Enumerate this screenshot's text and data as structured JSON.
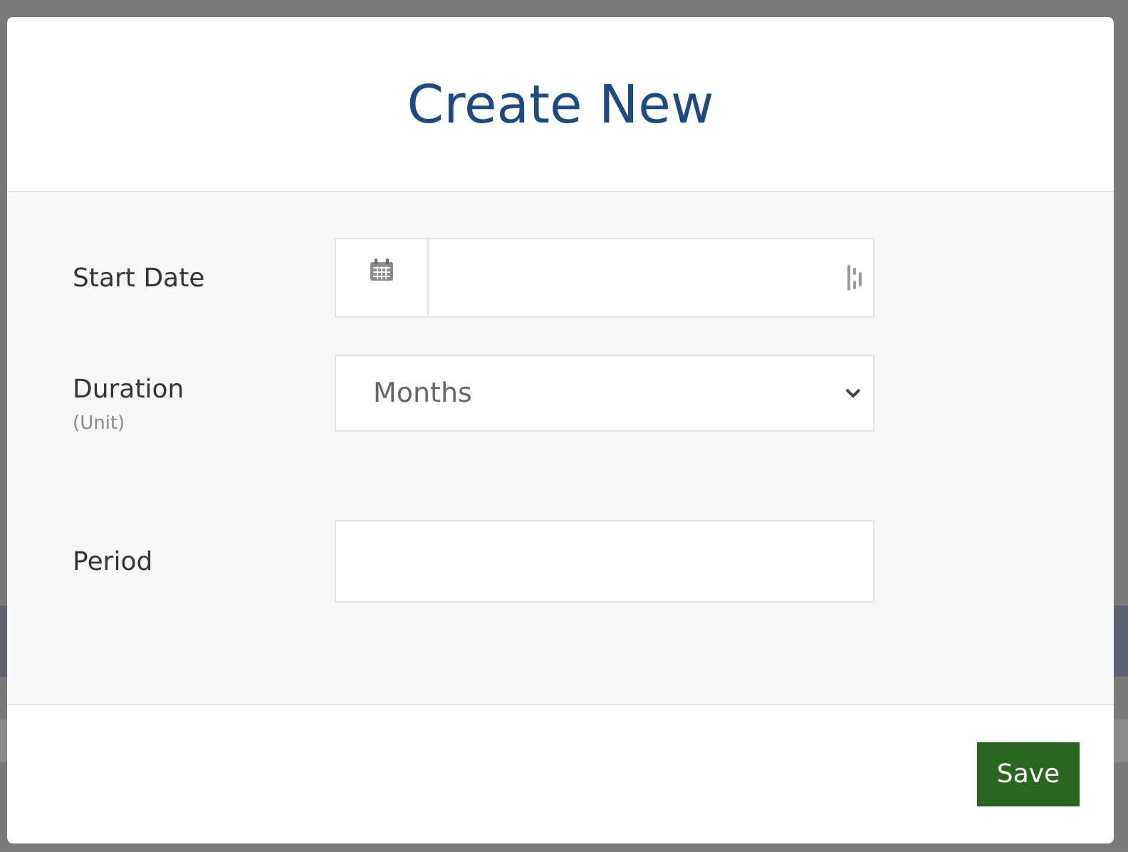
{
  "dialog": {
    "title": "Create New"
  },
  "fields": [
    {
      "kind": "date",
      "label": "Start Date"
    },
    {
      "kind": "select",
      "label": "Duration",
      "hint": "(Unit)",
      "value": "Months"
    },
    {
      "kind": "text",
      "label": "Period"
    }
  ],
  "buttons": [
    "Save"
  ]
}
